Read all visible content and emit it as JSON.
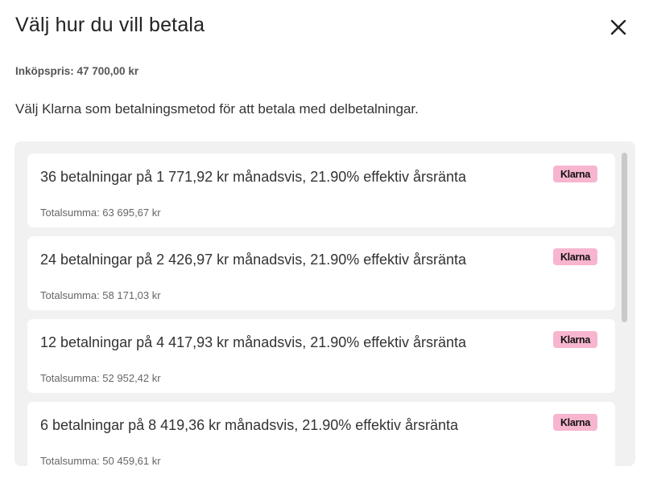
{
  "dialog": {
    "title": "Välj hur du vill betala",
    "price_label": "Inköpspris: 47 700,00 kr",
    "description": "Välj Klarna som betalningsmetod för att betala med delbetalningar."
  },
  "options": [
    {
      "title": "36 betalningar på 1 771,92 kr månadsvis, 21.90% effektiv årsränta",
      "total": "Totalsumma: 63 695,67 kr",
      "badge": "Klarna"
    },
    {
      "title": "24 betalningar på 2 426,97 kr månadsvis, 21.90% effektiv årsränta",
      "total": "Totalsumma: 58 171,03 kr",
      "badge": "Klarna"
    },
    {
      "title": "12 betalningar på 4 417,93 kr månadsvis, 21.90% effektiv årsränta",
      "total": "Totalsumma: 52 952,42 kr",
      "badge": "Klarna"
    },
    {
      "title": "6 betalningar på 8 419,36 kr månadsvis, 21.90% effektiv årsränta",
      "total": "Totalsumma: 50 459,61 kr",
      "badge": "Klarna"
    }
  ],
  "icons": {
    "close": "close-icon"
  },
  "colors": {
    "klarna_badge": "#f7b5cf",
    "panel_background": "#f1f1f1"
  }
}
